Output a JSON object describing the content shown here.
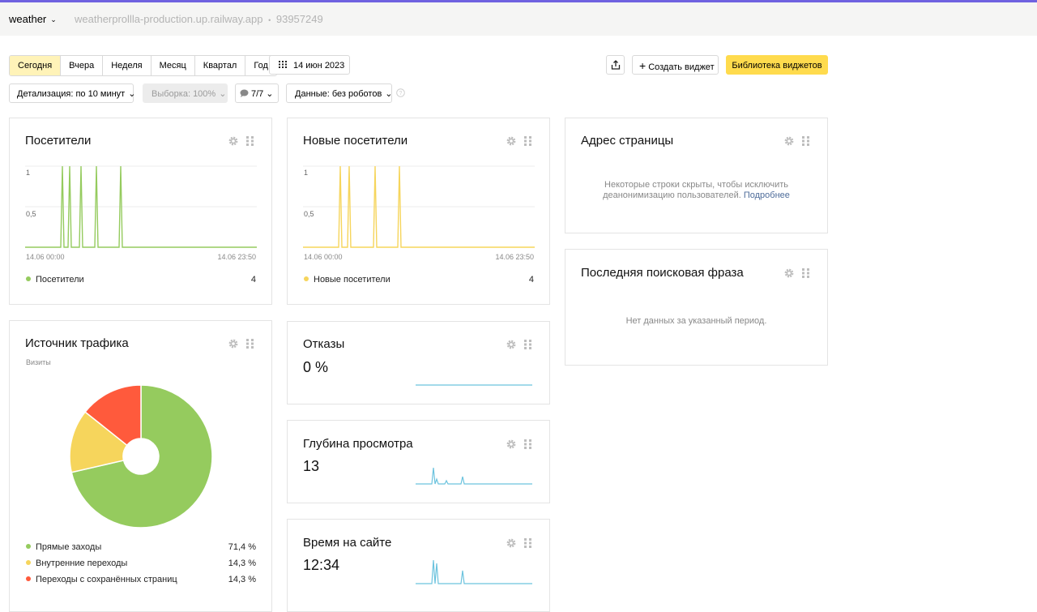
{
  "header": {
    "counter_name": "weather",
    "site": "weatherprollla-production.up.railway.app",
    "separator": "•",
    "counter_id": "93957249"
  },
  "period_tabs": [
    "Сегодня",
    "Вчера",
    "Неделя",
    "Месяц",
    "Квартал",
    "Год"
  ],
  "period_active": "Сегодня",
  "date_picker": {
    "label": "14 июн 2023",
    "icon": "calendar-icon"
  },
  "toolbar": {
    "create_widget": "Создать виджет",
    "widget_library": "Библиотека виджетов",
    "export_icon": "share-icon"
  },
  "filters": {
    "detail": "Детализация: по 10 минут",
    "sample": "Выборка: 100%",
    "attribution": "7/7",
    "data": "Данные: без роботов"
  },
  "colors": {
    "green": "#95cb5e",
    "yellow": "#f6d55c",
    "red": "#ff5a3c",
    "cyan": "#6cc3de",
    "accent_yellow": "#ffdb4d"
  },
  "widgets": {
    "visitors": {
      "title": "Посетители",
      "y_ticks": [
        "1",
        "0,5"
      ],
      "x_start": "14.06 00:00",
      "x_end": "14.06 23:50",
      "legend": "Посетители",
      "total": "4"
    },
    "new_visitors": {
      "title": "Новые посетители",
      "y_ticks": [
        "1",
        "0,5"
      ],
      "x_start": "14.06 00:00",
      "x_end": "14.06 23:50",
      "legend": "Новые посетители",
      "total": "4"
    },
    "page_address": {
      "title": "Адрес страницы",
      "note": "Некоторые строки скрыты, чтобы исключить",
      "note2": "деанонимизацию пользователей.",
      "link": "Подробнее"
    },
    "last_search": {
      "title": "Последняя поисковая фраза",
      "note": "Нет данных за указанный период."
    },
    "traffic": {
      "title": "Источник трафика",
      "subtitle": "Визиты",
      "items": [
        {
          "label": "Прямые заходы",
          "value": "71,4 %",
          "share": 71.4
        },
        {
          "label": "Внутренние переходы",
          "value": "14,3 %",
          "share": 14.3
        },
        {
          "label": "Переходы с сохранённых страниц",
          "value": "14,3 %",
          "share": 14.3
        }
      ]
    },
    "bounces": {
      "title": "Отказы",
      "value": "0 %"
    },
    "depth": {
      "title": "Глубина просмотра",
      "value": "13"
    },
    "time": {
      "title": "Время на сайте",
      "value": "12:34"
    }
  }
}
